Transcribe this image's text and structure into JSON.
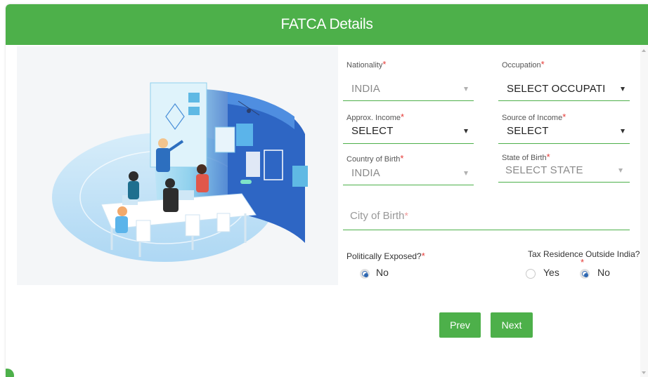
{
  "header": {
    "title": "FATCA Details"
  },
  "form": {
    "nationality": {
      "label": "Nationality",
      "value": "INDIA"
    },
    "occupation": {
      "label": "Occupation",
      "value": "SELECT OCCUPATI"
    },
    "approx_income": {
      "label": "Approx. Income",
      "value": "SELECT"
    },
    "source_of_income": {
      "label": "Source of Income",
      "value": "SELECT"
    },
    "country_of_birth": {
      "label": "Country of Birth",
      "value": "INDIA"
    },
    "state_of_birth": {
      "label": "State of Birth",
      "value": "SELECT STATE"
    },
    "city_of_birth": {
      "placeholder": "City of Birth"
    },
    "required_mark": "*",
    "politically_exposed": {
      "label": "Politically Exposed?",
      "options": [
        "No"
      ],
      "selected": "No"
    },
    "tax_residence": {
      "label": "Tax Residence Outside India?",
      "options": [
        "Yes",
        "No"
      ],
      "selected": "No"
    }
  },
  "buttons": {
    "prev": "Prev",
    "next": "Next"
  },
  "colors": {
    "accent": "#4db04a",
    "radio": "#2e67b1",
    "required": "#e53935"
  }
}
